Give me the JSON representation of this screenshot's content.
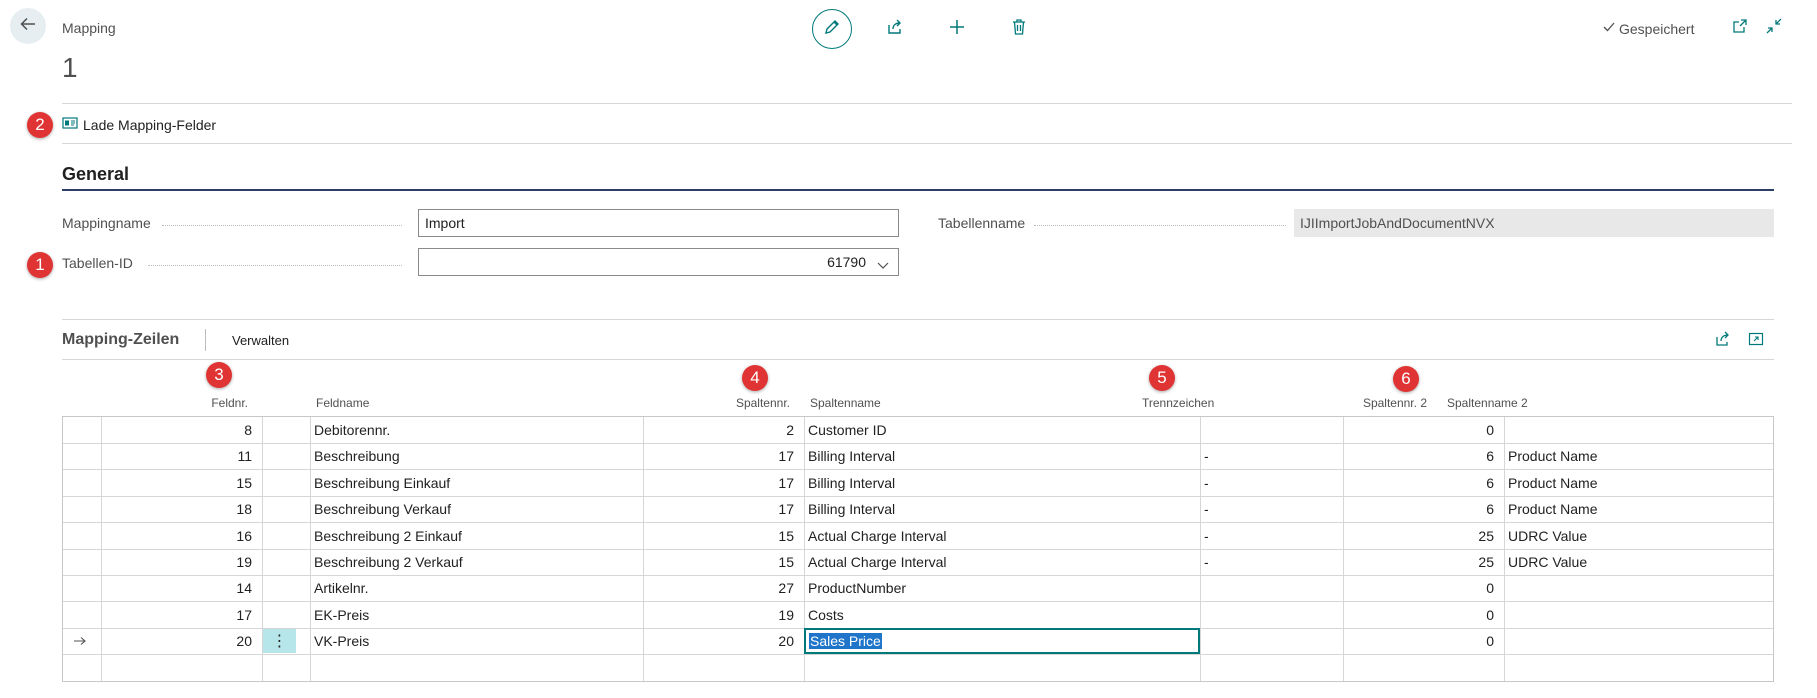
{
  "header": {
    "breadcrumb": "Mapping",
    "record_title": "1",
    "saved_label": "Gespeichert"
  },
  "actions": {
    "load_mapping_fields": "Lade Mapping-Felder"
  },
  "badges": [
    "1",
    "2",
    "3",
    "4",
    "5",
    "6"
  ],
  "general": {
    "title": "General",
    "mappingname_label": "Mappingname",
    "mappingname_value": "Import",
    "tabellen_id_label": "Tabellen-ID",
    "tabellen_id_value": "61790",
    "tabellenname_label": "Tabellenname",
    "tabellenname_value": "IJIImportJobAndDocumentNVX"
  },
  "lines": {
    "title": "Mapping-Zeilen",
    "manage_label": "Verwalten",
    "columns": {
      "feldnr": "Feldnr.",
      "feldname": "Feldname",
      "spaltennr": "Spaltennr.",
      "spaltenname": "Spaltenname",
      "trennzeichen": "Trennzeichen",
      "spaltennr2": "Spaltennr. 2",
      "spaltenname2": "Spaltenname 2"
    },
    "rows": [
      {
        "feldnr": "8",
        "feldname": "Debitorennr.",
        "spaltennr": "2",
        "spaltenname": "Customer ID",
        "trennzeichen": "",
        "spaltennr2": "0",
        "spaltenname2": ""
      },
      {
        "feldnr": "11",
        "feldname": "Beschreibung",
        "spaltennr": "17",
        "spaltenname": "Billing Interval",
        "trennzeichen": "-",
        "spaltennr2": "6",
        "spaltenname2": "Product Name"
      },
      {
        "feldnr": "15",
        "feldname": "Beschreibung Einkauf",
        "spaltennr": "17",
        "spaltenname": "Billing Interval",
        "trennzeichen": "-",
        "spaltennr2": "6",
        "spaltenname2": "Product Name"
      },
      {
        "feldnr": "18",
        "feldname": "Beschreibung Verkauf",
        "spaltennr": "17",
        "spaltenname": "Billing Interval",
        "trennzeichen": "-",
        "spaltennr2": "6",
        "spaltenname2": "Product Name"
      },
      {
        "feldnr": "16",
        "feldname": "Beschreibung 2 Einkauf",
        "spaltennr": "15",
        "spaltenname": "Actual Charge Interval",
        "trennzeichen": "-",
        "spaltennr2": "25",
        "spaltenname2": "UDRC Value"
      },
      {
        "feldnr": "19",
        "feldname": "Beschreibung 2 Verkauf",
        "spaltennr": "15",
        "spaltenname": "Actual Charge Interval",
        "trennzeichen": "-",
        "spaltennr2": "25",
        "spaltenname2": "UDRC Value"
      },
      {
        "feldnr": "14",
        "feldname": "Artikelnr.",
        "spaltennr": "27",
        "spaltenname": "ProductNumber",
        "trennzeichen": "",
        "spaltennr2": "0",
        "spaltenname2": ""
      },
      {
        "feldnr": "17",
        "feldname": "EK-Preis",
        "spaltennr": "19",
        "spaltenname": "Costs",
        "trennzeichen": "",
        "spaltennr2": "0",
        "spaltenname2": ""
      },
      {
        "feldnr": "20",
        "feldname": "VK-Preis",
        "spaltennr": "20",
        "spaltenname": "Sales Price",
        "trennzeichen": "",
        "spaltennr2": "0",
        "spaltenname2": ""
      },
      {
        "feldnr": "",
        "feldname": "",
        "spaltennr": "",
        "spaltenname": "",
        "trennzeichen": "",
        "spaltennr2": "",
        "spaltenname2": ""
      }
    ]
  },
  "icons": {
    "back": "arrow-left-icon",
    "edit": "pencil-icon",
    "share": "share-icon",
    "add": "plus-icon",
    "delete": "trash-icon",
    "saved": "checkmark-icon",
    "popout": "open-new-window-icon",
    "collapse": "collapse-icon",
    "load": "id-card-icon",
    "row_marker": "arrow-right-icon",
    "row_menu": "more-vertical-icon"
  },
  "colors": {
    "accent": "#00797a",
    "badge": "#e03434",
    "section_line": "#2c3e66",
    "selection": "#1f75c9"
  }
}
